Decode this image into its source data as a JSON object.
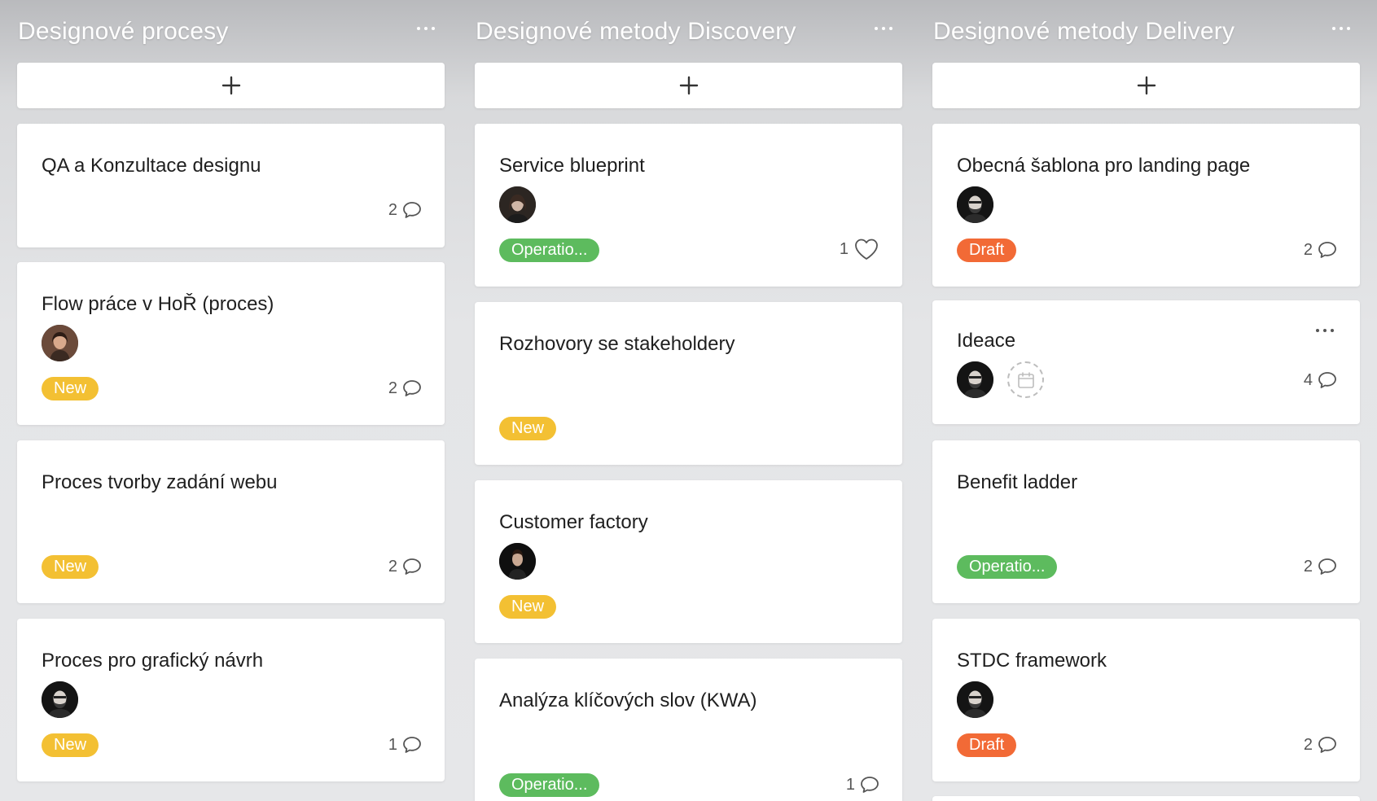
{
  "columns": [
    {
      "title": "Designové procesy",
      "cards": [
        {
          "title": "QA a Konzultace designu",
          "badge": "",
          "count": "2",
          "count_icon": "comment-icon"
        },
        {
          "title": "Flow práce v HoŘ (proces)",
          "badge": "New",
          "count": "2",
          "count_icon": "comment-icon"
        },
        {
          "title": "Proces tvorby zadání webu",
          "badge": "New",
          "count": "2",
          "count_icon": "comment-icon"
        },
        {
          "title": "Proces pro grafický návrh",
          "badge": "New",
          "count": "1",
          "count_icon": "comment-icon"
        }
      ]
    },
    {
      "title": "Designové metody Discovery",
      "cards": [
        {
          "title": "Service blueprint",
          "badge": "Operatio...",
          "count": "1",
          "count_icon": "heart-icon"
        },
        {
          "title": "Rozhovory se stakeholdery",
          "badge": "New",
          "count": "",
          "count_icon": ""
        },
        {
          "title": "Customer factory",
          "badge": "New",
          "count": "",
          "count_icon": ""
        },
        {
          "title": "Analýza klíčových slov (KWA)",
          "badge": "Operatio...",
          "count": "1",
          "count_icon": "comment-icon"
        }
      ]
    },
    {
      "title": "Designové metody Delivery",
      "cards": [
        {
          "title": "Obecná šablona pro landing page",
          "badge": "Draft",
          "count": "2",
          "count_icon": "comment-icon"
        },
        {
          "title": "Ideace",
          "badge": "",
          "count": "4",
          "count_icon": "comment-icon"
        },
        {
          "title": "Benefit ladder",
          "badge": "Operatio...",
          "count": "2",
          "count_icon": "comment-icon"
        },
        {
          "title": "STDC framework",
          "badge": "Draft",
          "count": "2",
          "count_icon": "comment-icon"
        }
      ]
    }
  ],
  "colors": {
    "new": "#f3c033",
    "draft": "#f26a36",
    "operatio": "#5dbb5e",
    "card_bg": "#ffffff",
    "column_title": "#ffffff"
  },
  "icons": {
    "add": "plus-icon",
    "column_menu": "more-horizontal-icon",
    "comment": "comment-icon",
    "like": "heart-icon",
    "date": "calendar-icon"
  }
}
